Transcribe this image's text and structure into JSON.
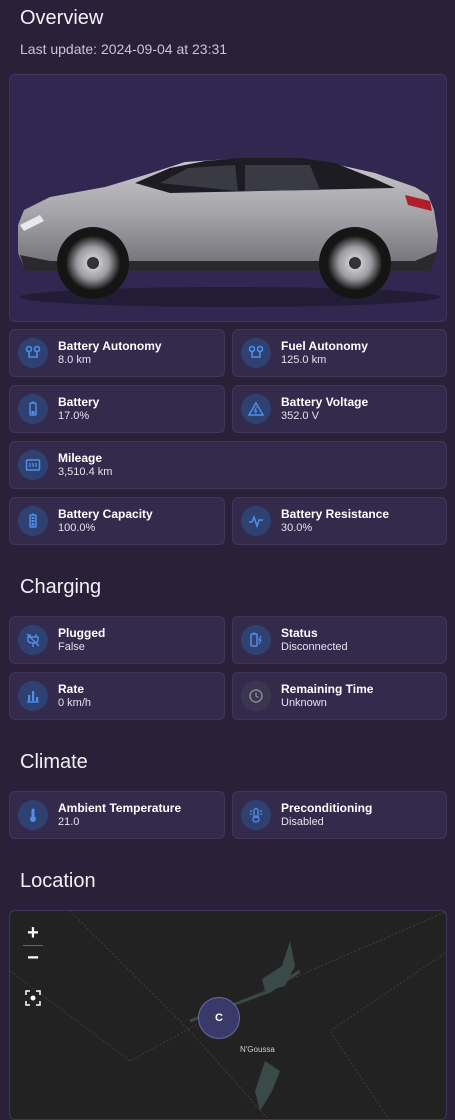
{
  "overview": {
    "title": "Overview",
    "last_update": "Last update: 2024-09-04 at 23:31",
    "tiles": [
      {
        "name": "Battery Autonomy",
        "value": "8.0 km",
        "icon": "route-icon"
      },
      {
        "name": "Fuel Autonomy",
        "value": "125.0 km",
        "icon": "route-icon"
      },
      {
        "name": "Battery",
        "value": "17.0%",
        "icon": "battery-icon"
      },
      {
        "name": "Battery Voltage",
        "value": "352.0 V",
        "icon": "voltage-warning-icon"
      },
      {
        "name": "Mileage",
        "value": "3,510.4 km",
        "icon": "odometer-icon"
      },
      {
        "name": "Battery Capacity",
        "value": "100.0%",
        "icon": "battery-full-icon"
      },
      {
        "name": "Battery Resistance",
        "value": "30.0%",
        "icon": "pulse-icon"
      }
    ]
  },
  "charging": {
    "title": "Charging",
    "tiles": [
      {
        "name": "Plugged",
        "value": "False",
        "icon": "power-plug-off-icon"
      },
      {
        "name": "Status",
        "value": "Disconnected",
        "icon": "battery-charging-icon"
      },
      {
        "name": "Rate",
        "value": "0 km/h",
        "icon": "bar-chart-icon"
      },
      {
        "name": "Remaining Time",
        "value": "Unknown",
        "icon": "clock-icon"
      }
    ]
  },
  "climate": {
    "title": "Climate",
    "tiles": [
      {
        "name": "Ambient Temperature",
        "value": "21.0",
        "icon": "thermometer-icon"
      },
      {
        "name": "Preconditioning",
        "value": "Disabled",
        "icon": "thermostat-icon"
      }
    ]
  },
  "location": {
    "title": "Location",
    "zoom_in": "+",
    "zoom_out": "−",
    "marker_label": "C",
    "place_name": "N'Goussa"
  },
  "colors": {
    "background": "#2a2139",
    "tile": "#332a4c",
    "icon_accent": "#4f8fe8"
  }
}
